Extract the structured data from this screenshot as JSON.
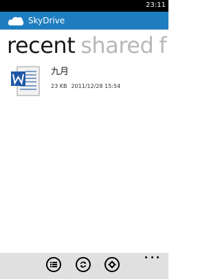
{
  "status_bar": {
    "time": "23:11"
  },
  "app": {
    "title": "SkyDrive",
    "logo_icon": "cloud-icon",
    "brand_color": "#1d7dbf"
  },
  "pivot": {
    "tabs": [
      {
        "label": "recent",
        "active": true
      },
      {
        "label": "shared",
        "active": false
      },
      {
        "label": "f",
        "active": false
      }
    ]
  },
  "files": [
    {
      "name": "九月",
      "size": "23 KB",
      "date": "2011/12/28 15:54",
      "icon": "word-document-icon"
    }
  ],
  "app_bar": {
    "buttons": [
      {
        "icon": "list-icon"
      },
      {
        "icon": "refresh-icon"
      },
      {
        "icon": "settings-icon"
      }
    ],
    "more_icon": "more-icon"
  }
}
